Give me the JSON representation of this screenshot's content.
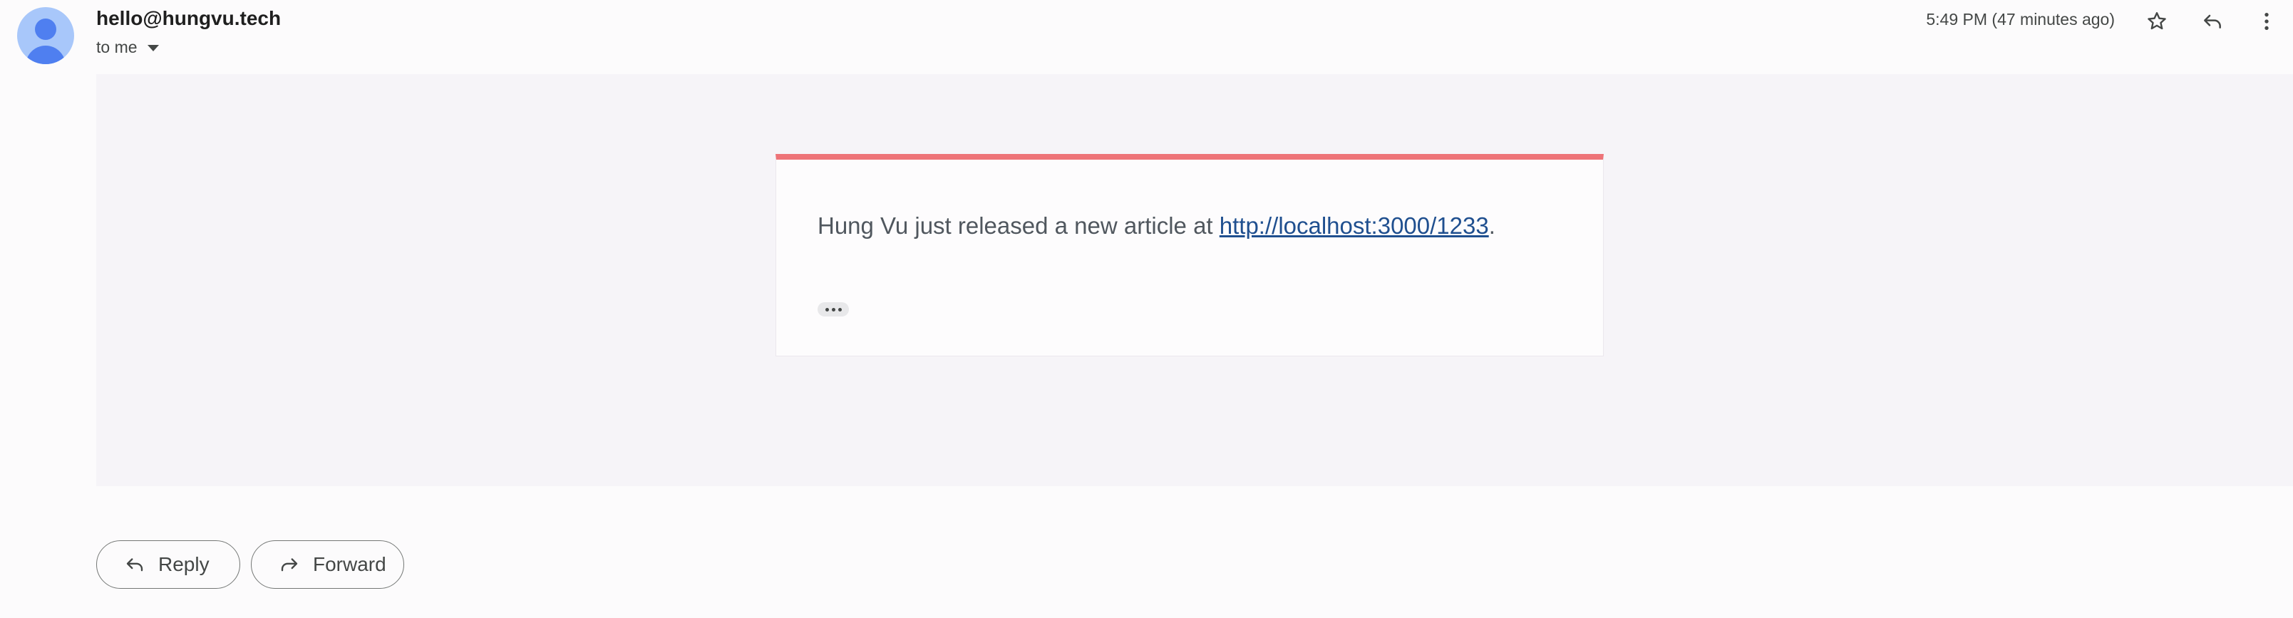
{
  "header": {
    "sender": "hello@hungvu.tech",
    "recipient": "to me",
    "timestamp": "5:49 PM (47 minutes ago)",
    "icons": [
      "star-icon",
      "reply-icon",
      "more-vert-icon"
    ]
  },
  "message": {
    "text_before": "Hung Vu just released a new article at ",
    "link_text": "http://localhost:3000/1233",
    "text_after": ".",
    "accent_color": "#ee7378",
    "link_color": "#1f4f8f"
  },
  "actions": {
    "reply_label": "Reply",
    "forward_label": "Forward"
  }
}
